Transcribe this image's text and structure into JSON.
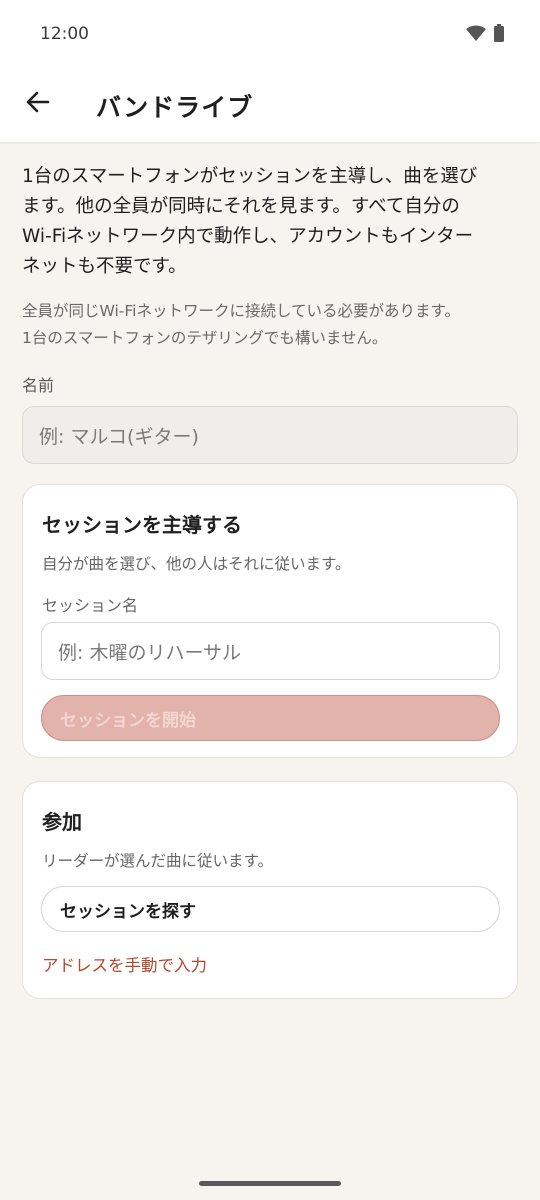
{
  "status_bar": {
    "time": "12:00",
    "icons": [
      "wifi-icon",
      "battery-icon"
    ]
  },
  "app_bar": {
    "back_icon": "arrow-left-icon",
    "title": "バンドライブ"
  },
  "intro": {
    "line1": "1台のスマートフォンがセッションを主導し、曲を選び",
    "line2": "ます。他の全員が同時にそれを見ます。すべて自分の",
    "line3": "Wi-Fiネットワーク内で動作し、アカウントもインター",
    "line4": "ネットも不要です。"
  },
  "note": {
    "line1": "全員が同じWi-Fiネットワークに接続している必要があります。",
    "line2": "1台のスマートフォンのテザリングでも構いません。"
  },
  "name": {
    "label": "名前",
    "value": "",
    "placeholder": "例: マルコ(ギター)"
  },
  "lead_card": {
    "title": "セッションを主導する",
    "description": "自分が曲を選び、他の人はそれに従います。",
    "session_name_label": "セッション名",
    "session_name_value": "",
    "session_name_placeholder": "例: 木曜のリハーサル",
    "start_button": "セッションを開始"
  },
  "join_card": {
    "title": "参加",
    "description": "リーダーが選んだ曲に従います。",
    "find_button": "セッションを探す",
    "manual_link": "アドレスを手動で入力"
  },
  "colors": {
    "background": "#f5f4ef",
    "accent": "#b5472e",
    "start_button_disabled": "#e1b3ab"
  }
}
